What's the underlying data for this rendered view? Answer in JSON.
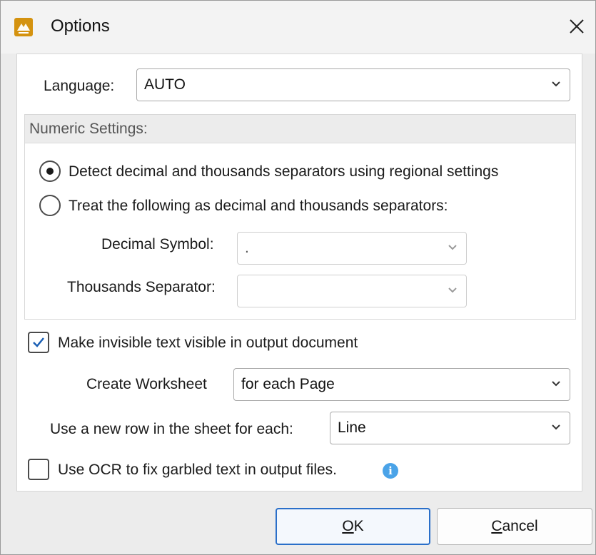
{
  "window": {
    "title": "Options",
    "close_icon": "close-icon",
    "app_icon": "pdf-xchange-logo-icon"
  },
  "language": {
    "label": "Language:",
    "value": "AUTO"
  },
  "numeric_settings": {
    "header": "Numeric Settings:",
    "option_detect": {
      "label": "Detect decimal and thousands separators using regional settings",
      "checked": true
    },
    "option_treat": {
      "label": "Treat the following as decimal and thousands separators:",
      "checked": false
    },
    "decimal_symbol": {
      "label": "Decimal Symbol:",
      "value": "."
    },
    "thousands_separator": {
      "label": "Thousands Separator:",
      "value": ""
    }
  },
  "make_invisible_visible": {
    "label": "Make invisible text visible in output document",
    "checked": true
  },
  "create_worksheet": {
    "label": "Create Worksheet",
    "value": "for each Page"
  },
  "new_row": {
    "label": "Use a new row in the sheet for each:",
    "value": "Line"
  },
  "use_ocr": {
    "label": "Use OCR to fix garbled text in output files.",
    "checked": false,
    "info_icon": "info-icon"
  },
  "buttons": {
    "ok": "OK",
    "cancel": "Cancel"
  },
  "colors": {
    "accent": "#2a6fc9",
    "info": "#4aa3e8",
    "app_icon": "#d4920f"
  }
}
